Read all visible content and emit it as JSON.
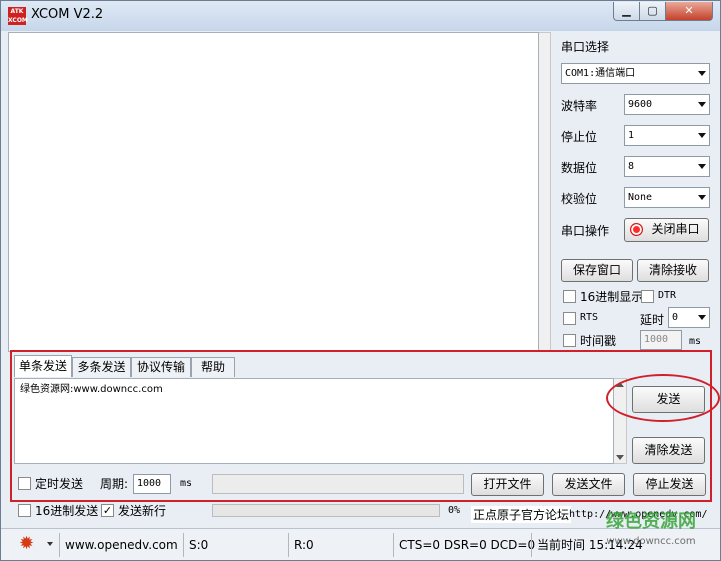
{
  "window": {
    "title": "XCOM V2.2",
    "logo_text": "ATK XCOM",
    "controls": {
      "minimize": "▁",
      "maximize": "▢",
      "close": "✕"
    }
  },
  "port_panel": {
    "port_select_label": "串口选择",
    "port_value": "COM1:通信端口",
    "baud_label": "波特率",
    "baud_value": "9600",
    "stopbits_label": "停止位",
    "stopbits_value": "1",
    "databits_label": "数据位",
    "databits_value": "8",
    "parity_label": "校验位",
    "parity_value": "None",
    "operation_label": "串口操作",
    "close_port_button": "关闭串口",
    "save_window_button": "保存窗口",
    "clear_receive_button": "清除接收",
    "hex_display_label": "16进制显示",
    "dtr_label": "DTR",
    "rts_label": "RTS",
    "delay_label": "延时",
    "delay_value": "0",
    "timestamp_label": "时间戳",
    "timestamp_value": "1000",
    "ms_label": "ms"
  },
  "send": {
    "tabs": [
      "单条发送",
      "多条发送",
      "协议传输",
      "帮助"
    ],
    "text": "绿色资源网:www.downcc.com",
    "send_button": "发送",
    "clear_send_button": "清除发送",
    "timed_send_label": "定时发送",
    "period_label": "周期:",
    "period_value": "1000",
    "period_unit": "ms",
    "open_file_button": "打开文件",
    "send_file_button": "发送文件",
    "stop_send_button": "停止发送",
    "hex_send_label": "16进制发送",
    "newline_label": "发送新行",
    "progress_percent": "0%",
    "progress_fraction": 0,
    "forum_label": "正点原子官方论坛",
    "forum_url": "http://www.openedv.com/"
  },
  "status": {
    "website": "www.openedv.com",
    "sent": "S:0",
    "received": "R:0",
    "signals": "CTS=0 DSR=0 DCD=0",
    "time_label": "当前时间",
    "time_value": "15:14:24"
  },
  "watermark": {
    "line1": "绿色资源网",
    "line2": "www.downcc.com"
  },
  "colors": {
    "highlight": "#d0202a",
    "progress": "#06b025",
    "gear": "#d63a14"
  }
}
